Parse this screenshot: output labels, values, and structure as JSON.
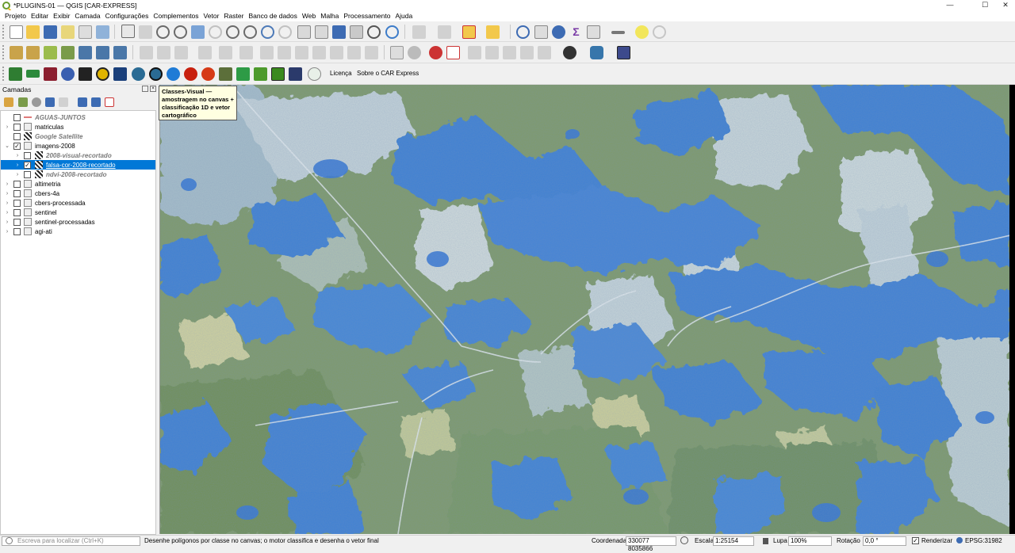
{
  "window": {
    "title": "*PLUGINS-01 — QGIS [CAR-EXPRESS]",
    "controls": {
      "minimize": "—",
      "maximize": "☐",
      "close": "✕"
    }
  },
  "menu": [
    "Projeto",
    "Editar",
    "Exibir",
    "Camada",
    "Configurações",
    "Complementos",
    "Vetor",
    "Raster",
    "Banco de dados",
    "Web",
    "Malha",
    "Processamento",
    "Ajuda"
  ],
  "toolbar3": {
    "licenca": "Licença",
    "sobre": "Sobre o CAR Express"
  },
  "tooltip": {
    "text": "Classes-Visual — amostragem no canvas + classificação 1D e vetor cartográfico"
  },
  "panel": {
    "title": "Camadas"
  },
  "layers": [
    {
      "name": "AGUAS-JUNTOS",
      "icon": "line-layer-icon",
      "style": "italic",
      "checked": false,
      "expander": ""
    },
    {
      "name": "matriculas",
      "icon": "group-icon",
      "style": "normal",
      "checked": false,
      "expander": "›"
    },
    {
      "name": "Google Satellite",
      "icon": "raster-layer-icon",
      "style": "italic",
      "checked": false,
      "expander": ""
    },
    {
      "name": "imagens-2008",
      "icon": "group-icon",
      "style": "normal",
      "checked": true,
      "expander": "⌄"
    },
    {
      "name": "2008-visual-recortado",
      "icon": "raster-layer-icon",
      "style": "italic",
      "checked": false,
      "expander": "›"
    },
    {
      "name": "falsa-cor-2008-recortado",
      "icon": "raster-layer-icon",
      "style": "selected",
      "checked": true,
      "expander": "›"
    },
    {
      "name": "ndvi-2008-recortado",
      "icon": "raster-layer-icon",
      "style": "italic",
      "checked": false,
      "expander": "›"
    },
    {
      "name": "altimetria",
      "icon": "group-icon",
      "style": "normal",
      "checked": false,
      "expander": "›"
    },
    {
      "name": "cbers-4a",
      "icon": "group-icon",
      "style": "normal",
      "checked": false,
      "expander": "›"
    },
    {
      "name": "cbers-processada",
      "icon": "group-icon",
      "style": "normal",
      "checked": false,
      "expander": "›"
    },
    {
      "name": "sentinel",
      "icon": "group-icon",
      "style": "normal",
      "checked": false,
      "expander": "›"
    },
    {
      "name": "sentinel-processadas",
      "icon": "group-icon",
      "style": "normal",
      "checked": false,
      "expander": "›"
    },
    {
      "name": "agi-ati",
      "icon": "group-icon",
      "style": "normal",
      "checked": false,
      "expander": "›"
    }
  ],
  "status": {
    "locator_placeholder": "Escreva para localizar (Ctrl+K)",
    "message": "Desenhe polígonos por classe no canvas; o motor classifica e desenha o vetor final",
    "coord_label": "Coordenada",
    "coord_value": "330077 8035866",
    "scale_label": "Escala",
    "scale_value": "1:25154",
    "lupa_label": "Lupa",
    "lupa_value": "100%",
    "rotation_label": "Rotação",
    "rotation_value": "0,0 °",
    "render_label": "Renderizar",
    "crs": "EPSG:31982"
  },
  "colors": {
    "selection": "#0078d7",
    "map_blue": "#3a7fd9",
    "map_green": "#7a9a63"
  }
}
